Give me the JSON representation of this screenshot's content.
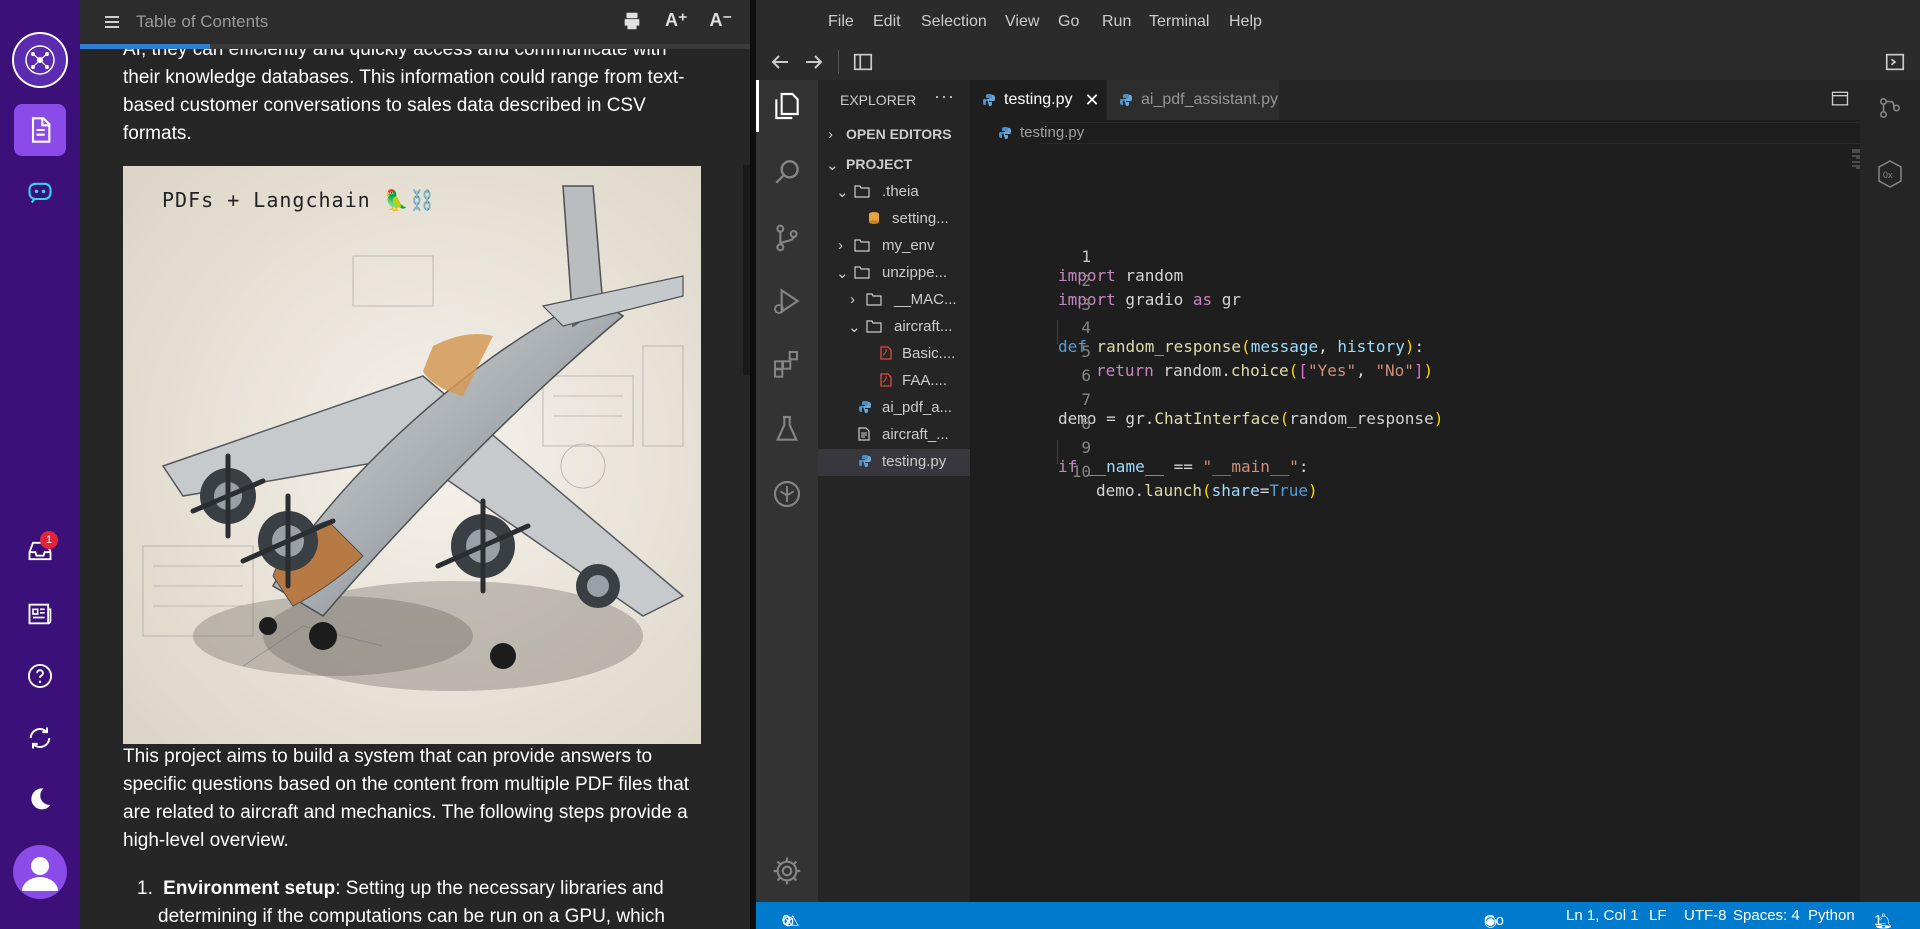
{
  "rail": {
    "inbox_badge": "1"
  },
  "reader": {
    "toc_title": "Table of Contents",
    "font_increase": "A⁺",
    "font_decrease": "A⁻",
    "para_top_lines": [
      "AI, they can efficiently and quickly access and communicate with",
      "their knowledge databases. This information could range from text-",
      "based customer conversations to sales data described in CSV",
      "formats."
    ],
    "figure_caption": "PDFs + Langchain 🦜⛓️",
    "para_bottom_lines": [
      "This project aims to build a system that can provide answers to",
      "specific questions based on the content from multiple PDF files that",
      "are related to aircraft and mechanics. The following steps provide a",
      "high-level overview."
    ],
    "list_number": "1.",
    "list_bold": "Environment setup",
    "list_line1_rest": ": Setting up the necessary libraries and",
    "list_line2": "determining if the computations can be run on a GPU, which"
  },
  "vscode": {
    "menu": [
      "File",
      "Edit",
      "Selection",
      "View",
      "Go",
      "Run",
      "Terminal",
      "Help"
    ],
    "explorer_title": "EXPLORER",
    "explorer_more": "···",
    "open_editors": "OPEN EDITORS",
    "project": "PROJECT",
    "tree": [
      ".theia",
      "setting...",
      "my_env",
      "unzippe...",
      "__MAC...",
      "aircraft...",
      "Basic....",
      "FAA....",
      "ai_pdf_a...",
      "aircraft_...",
      "testing.py"
    ],
    "tabs": [
      "testing.py",
      "ai_pdf_assistant.py"
    ],
    "breadcrumb": "testing.py",
    "line_numbers": [
      "1",
      "2",
      "3",
      "4",
      "5",
      "6",
      "7",
      "8",
      "9",
      "10"
    ],
    "code": {
      "l1_kw": "import",
      "l1_rest": " random",
      "l2_kw": "import",
      "l2_mid": " gradio ",
      "l2_as": "as",
      "l2_rest": " gr",
      "l4_def": "def",
      "l4_fn": "random_response",
      "l4_p1": "message",
      "l4_p2": "history",
      "l5_ret": "return",
      "l5_mid": " random.",
      "l5_fn": "choice",
      "l5_s1": "\"Yes\"",
      "l5_s2": "\"No\"",
      "l7_lhs": "demo = gr.",
      "l7_fn": "ChatInterface",
      "l7_arg": "random_response",
      "l9_if": "if",
      "l9_name": "__name__",
      "l9_op": " == ",
      "l9_str": "\"__main__\"",
      "l9_colon": ":",
      "l10_obj": "demo.",
      "l10_fn": "launch",
      "l10_kw": "share",
      "l10_eq": "=",
      "l10_val": "True"
    },
    "status": {
      "errors": "0",
      "warnings": "0",
      "go_live": "Go Live",
      "position": "Ln 1, Col 1",
      "eol": "LF",
      "encoding": "UTF-8",
      "spaces": "Spaces: 4",
      "language": "Python",
      "notifications": "1"
    }
  },
  "colors": {
    "rail_bg": "#3b1078",
    "rail_active": "#8a4be8",
    "status_bar": "#007acc",
    "reader_bg": "#262626",
    "toc_progress": "#2f7fd6"
  }
}
